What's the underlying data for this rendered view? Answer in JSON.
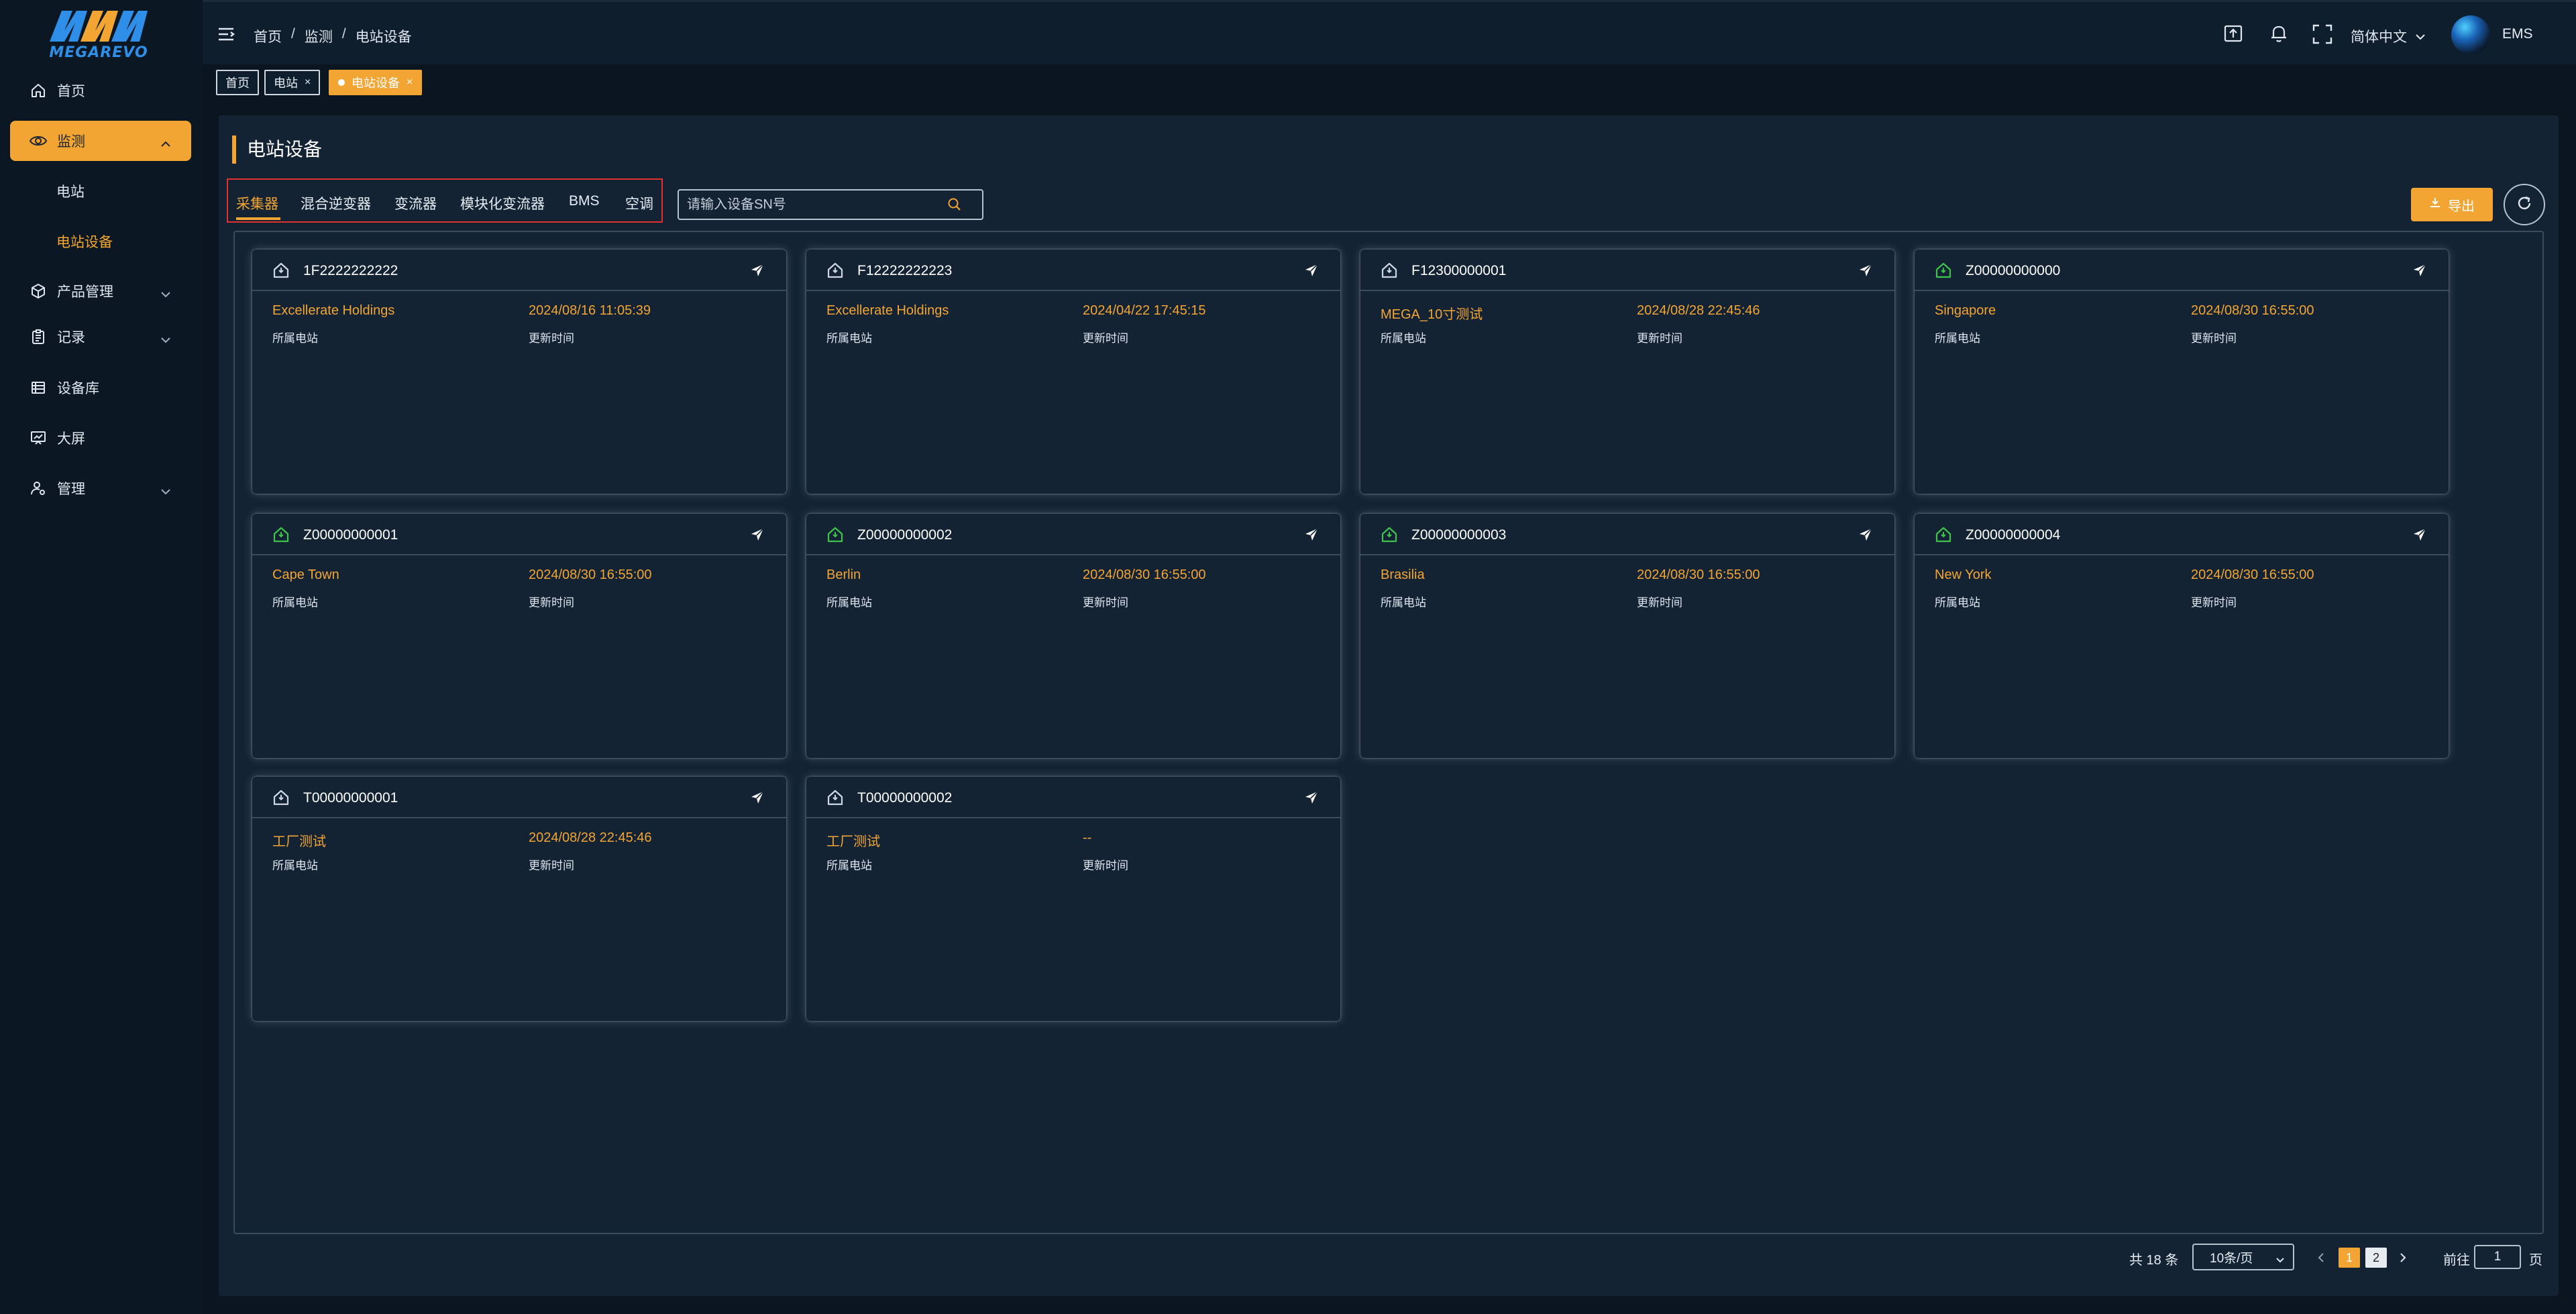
{
  "brand": {
    "logo_text": "MEGAREVO"
  },
  "sidebar": {
    "items": [
      {
        "label": "首页",
        "icon": "home-icon"
      },
      {
        "label": "监测",
        "icon": "eye-icon",
        "expanded": true,
        "active": true
      },
      {
        "label": "电站",
        "sub": true
      },
      {
        "label": "电站设备",
        "sub": true,
        "active": true
      },
      {
        "label": "产品管理",
        "icon": "cube-icon"
      },
      {
        "label": "记录",
        "icon": "clipboard-icon"
      },
      {
        "label": "设备库",
        "icon": "list-icon"
      },
      {
        "label": "大屏",
        "icon": "screen-icon"
      },
      {
        "label": "管理",
        "icon": "user-gear-icon"
      }
    ]
  },
  "header": {
    "breadcrumb": [
      "首页",
      "监测",
      "电站设备"
    ],
    "breadcrumb_sep": "/",
    "language": "简体中文",
    "username": "EMS"
  },
  "tabs": [
    {
      "label": "首页",
      "closable": false
    },
    {
      "label": "电站",
      "closable": true,
      "close": "×"
    },
    {
      "label": "电站设备",
      "closable": true,
      "close": "×",
      "active": true
    }
  ],
  "page": {
    "title": "电站设备",
    "device_tabs": [
      "采集器",
      "混合逆变器",
      "变流器",
      "模块化变流器",
      "BMS",
      "空调"
    ],
    "active_device_tab": "采集器",
    "search_placeholder": "请输入设备SN号",
    "export_label": "导出"
  },
  "labels": {
    "station": "所属电站",
    "update_time": "更新时间"
  },
  "cards": [
    {
      "sn": "1F2222222222",
      "station": "Excellerate Holdings",
      "time": "2024/08/16 11:05:39",
      "online": false
    },
    {
      "sn": "F12222222223",
      "station": "Excellerate Holdings",
      "time": "2024/04/22 17:45:15",
      "online": false
    },
    {
      "sn": "F12300000001",
      "station": "MEGA_10寸测试",
      "time": "2024/08/28 22:45:46",
      "online": false
    },
    {
      "sn": "Z00000000000",
      "station": "Singapore",
      "time": "2024/08/30 16:55:00",
      "online": true
    },
    {
      "sn": "Z00000000001",
      "station": "Cape Town",
      "time": "2024/08/30 16:55:00",
      "online": true
    },
    {
      "sn": "Z00000000002",
      "station": "Berlin",
      "time": "2024/08/30 16:55:00",
      "online": true
    },
    {
      "sn": "Z00000000003",
      "station": "Brasilia",
      "time": "2024/08/30 16:55:00",
      "online": true
    },
    {
      "sn": "Z00000000004",
      "station": "New York",
      "time": "2024/08/30 16:55:00",
      "online": true
    },
    {
      "sn": "T00000000001",
      "station": "工厂测试",
      "time": "2024/08/28 22:45:46",
      "online": false
    },
    {
      "sn": "T00000000002",
      "station": "工厂测试",
      "time": "--",
      "online": false
    }
  ],
  "pagination": {
    "total_text": "共 18 条",
    "page_size": "10条/页",
    "pages": [
      "1",
      "2"
    ],
    "current_page": "1",
    "goto_label": "前往",
    "goto_value": "1",
    "page_suffix": "页"
  },
  "colors": {
    "accent": "#f3a534",
    "online": "#3ec24a",
    "offline": "#cfd8e2",
    "alert_border": "#e0312f"
  }
}
